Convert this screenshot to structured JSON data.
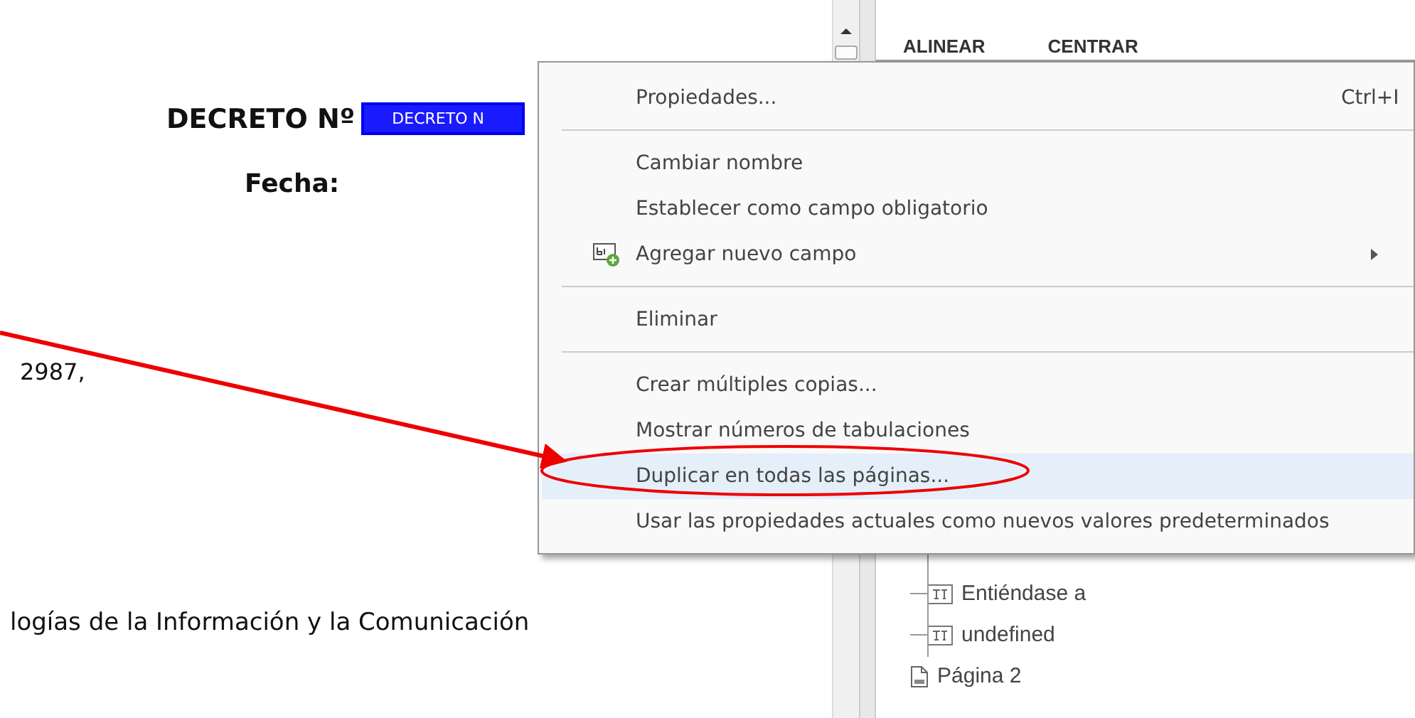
{
  "document": {
    "title_label": "DECRETO Nº",
    "title_field": {
      "value": "DECRETO N",
      "selected": true
    },
    "date_label": "Fecha:",
    "lines": [
      "2987,",
      "logías de la Información y la Comunicación"
    ]
  },
  "panel": {
    "columns": [
      "ALINEAR",
      "CENTRAR"
    ],
    "tree": [
      {
        "label": "Entiéndase a",
        "kind": "field"
      },
      {
        "label": "undefined",
        "kind": "field"
      },
      {
        "label": "Página 2",
        "kind": "page"
      }
    ]
  },
  "context_menu": {
    "items": [
      {
        "kind": "item",
        "label": "Propiedades...",
        "shortcut": "Ctrl+I",
        "selected": false
      },
      {
        "kind": "separator"
      },
      {
        "kind": "item",
        "label": "Cambiar nombre",
        "selected": false
      },
      {
        "kind": "item",
        "label": "Establecer como campo obligatorio",
        "selected": false
      },
      {
        "kind": "submenu",
        "label": "Agregar nuevo campo",
        "selected": false
      },
      {
        "kind": "separator"
      },
      {
        "kind": "item",
        "label": "Eliminar",
        "selected": false
      },
      {
        "kind": "separator"
      },
      {
        "kind": "item",
        "label": "Crear múltiples copias...",
        "selected": false
      },
      {
        "kind": "item",
        "label": "Mostrar números de tabulaciones",
        "selected": false
      },
      {
        "kind": "item",
        "label": "Duplicar en todas las páginas...",
        "selected": true
      },
      {
        "kind": "item",
        "label": "Usar las propiedades actuales como nuevos valores predeterminados",
        "selected": false
      }
    ]
  }
}
